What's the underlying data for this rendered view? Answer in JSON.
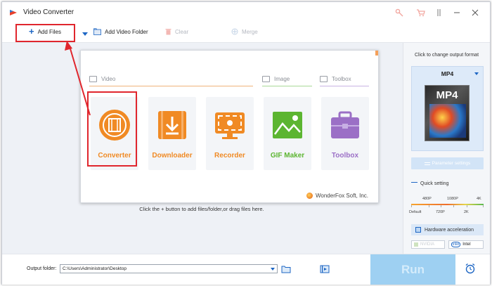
{
  "app": {
    "title": "Video Converter"
  },
  "toolbar": {
    "add_files": "Add Files",
    "add_video_folder": "Add Video Folder",
    "clear": "Clear",
    "merge": "Merge"
  },
  "panel": {
    "sections": {
      "video": "Video",
      "image": "Image",
      "toolbox": "Toolbox"
    },
    "tiles": [
      {
        "label": "Converter",
        "color": "#f08a24"
      },
      {
        "label": "Downloader",
        "color": "#f08a24"
      },
      {
        "label": "Recorder",
        "color": "#f08a24"
      },
      {
        "label": "GIF Maker",
        "color": "#5cb531"
      },
      {
        "label": "Toolbox",
        "color": "#9b6fc6"
      }
    ],
    "brand": "WonderFox Soft, Inc."
  },
  "hint": "Click the + button to add files/folder,or drag files here.",
  "right_panel": {
    "caption": "Click to change output format",
    "format": "MP4",
    "format_card": "MP4",
    "param_settings": "Parameter settings",
    "quick_setting": "Quick setting",
    "quality_top": [
      "480P",
      "1080P",
      "4K"
    ],
    "quality_bottom": [
      "Default",
      "720P",
      "2K"
    ],
    "hw_accel": "Hardware acceleration",
    "gpu": [
      "NVIDIA",
      "Intel"
    ]
  },
  "bottom": {
    "output_folder_label": "Output folder:",
    "output_folder_value": "C:\\Users\\Administrator\\Desktop",
    "run": "Run"
  },
  "colors": {
    "accent_blue": "#1d66c4",
    "annotation_red": "#e0262d",
    "run_button": "#9ed0f2"
  }
}
